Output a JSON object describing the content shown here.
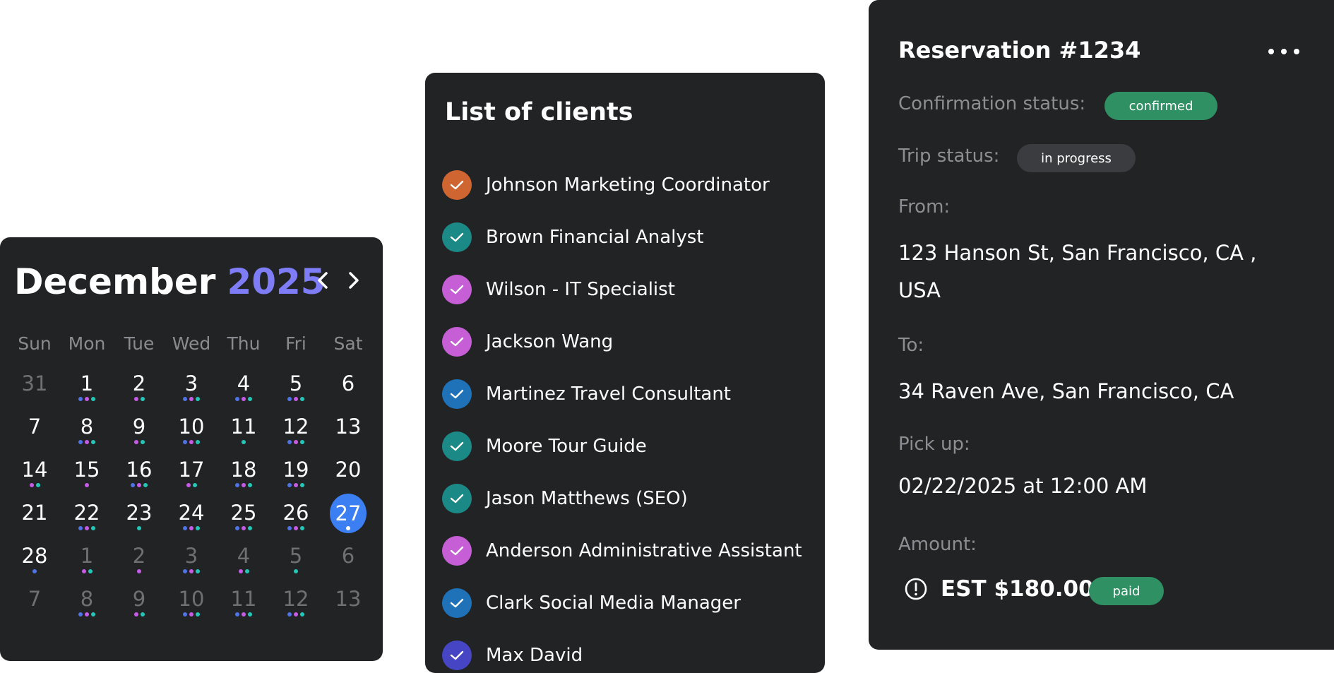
{
  "calendar": {
    "month": "December",
    "year": "2025",
    "prev_icon": "chevron-left-icon",
    "next_icon": "chevron-right-icon",
    "weekdays": [
      "Sun",
      "Mon",
      "Tue",
      "Wed",
      "Thu",
      "Fri",
      "Sat"
    ],
    "colors": {
      "text": "#ffffff",
      "muted": "#6f7074",
      "year_accent": "#7e7cf6",
      "today": "#3b7ff2",
      "dot_blue": "#4f74e8",
      "dot_purple": "#c65be6",
      "dot_teal": "#22c7b8"
    },
    "days": [
      {
        "day": "31",
        "muted": true,
        "dots": []
      },
      {
        "day": "1",
        "muted": false,
        "dots": [
          "blue",
          "purple",
          "teal"
        ]
      },
      {
        "day": "2",
        "muted": false,
        "dots": [
          "purple",
          "teal"
        ]
      },
      {
        "day": "3",
        "muted": false,
        "dots": [
          "blue",
          "purple",
          "teal"
        ]
      },
      {
        "day": "4",
        "muted": false,
        "dots": [
          "blue",
          "purple",
          "teal"
        ]
      },
      {
        "day": "5",
        "muted": false,
        "dots": [
          "blue",
          "purple",
          "teal"
        ]
      },
      {
        "day": "6",
        "muted": false,
        "dots": []
      },
      {
        "day": "7",
        "muted": false,
        "dots": []
      },
      {
        "day": "8",
        "muted": false,
        "dots": [
          "blue",
          "purple",
          "teal"
        ]
      },
      {
        "day": "9",
        "muted": false,
        "dots": [
          "purple",
          "teal"
        ]
      },
      {
        "day": "10",
        "muted": false,
        "dots": [
          "blue",
          "purple",
          "teal"
        ]
      },
      {
        "day": "11",
        "muted": false,
        "dots": [
          "teal"
        ]
      },
      {
        "day": "12",
        "muted": false,
        "dots": [
          "blue",
          "purple",
          "teal"
        ]
      },
      {
        "day": "13",
        "muted": false,
        "dots": []
      },
      {
        "day": "14",
        "muted": false,
        "dots": [
          "purple",
          "teal"
        ]
      },
      {
        "day": "15",
        "muted": false,
        "dots": [
          "purple"
        ]
      },
      {
        "day": "16",
        "muted": false,
        "dots": [
          "blue",
          "purple",
          "teal"
        ]
      },
      {
        "day": "17",
        "muted": false,
        "dots": [
          "purple",
          "teal"
        ]
      },
      {
        "day": "18",
        "muted": false,
        "dots": [
          "blue",
          "purple",
          "teal"
        ]
      },
      {
        "day": "19",
        "muted": false,
        "dots": [
          "blue",
          "purple",
          "teal"
        ]
      },
      {
        "day": "20",
        "muted": false,
        "dots": []
      },
      {
        "day": "21",
        "muted": false,
        "dots": []
      },
      {
        "day": "22",
        "muted": false,
        "dots": [
          "blue",
          "purple",
          "teal"
        ]
      },
      {
        "day": "23",
        "muted": false,
        "dots": [
          "teal"
        ]
      },
      {
        "day": "24",
        "muted": false,
        "dots": [
          "blue",
          "purple",
          "teal"
        ]
      },
      {
        "day": "25",
        "muted": false,
        "dots": [
          "blue",
          "purple",
          "teal"
        ]
      },
      {
        "day": "26",
        "muted": false,
        "dots": [
          "blue",
          "purple",
          "teal"
        ]
      },
      {
        "day": "27",
        "muted": false,
        "today": true,
        "dots": [
          "white"
        ]
      },
      {
        "day": "28",
        "muted": false,
        "dots": [
          "blue"
        ]
      },
      {
        "day": "1",
        "muted": true,
        "dots": [
          "purple",
          "teal"
        ]
      },
      {
        "day": "2",
        "muted": true,
        "dots": [
          "purple"
        ]
      },
      {
        "day": "3",
        "muted": true,
        "dots": [
          "blue",
          "purple",
          "teal"
        ]
      },
      {
        "day": "4",
        "muted": true,
        "dots": [
          "purple",
          "teal"
        ]
      },
      {
        "day": "5",
        "muted": true,
        "dots": [
          "teal"
        ]
      },
      {
        "day": "6",
        "muted": true,
        "dots": []
      },
      {
        "day": "7",
        "muted": true,
        "dots": []
      },
      {
        "day": "8",
        "muted": true,
        "dots": [
          "blue",
          "purple",
          "teal"
        ]
      },
      {
        "day": "9",
        "muted": true,
        "dots": [
          "purple",
          "teal"
        ]
      },
      {
        "day": "10",
        "muted": true,
        "dots": [
          "blue",
          "purple",
          "teal"
        ]
      },
      {
        "day": "11",
        "muted": true,
        "dots": [
          "blue",
          "purple",
          "teal"
        ]
      },
      {
        "day": "12",
        "muted": true,
        "dots": [
          "blue",
          "purple",
          "teal"
        ]
      },
      {
        "day": "13",
        "muted": true,
        "dots": []
      }
    ]
  },
  "clients": {
    "title": "List of clients",
    "check_icon": "checkmark-icon",
    "items": [
      {
        "name": "Johnson Marketing Coordinator",
        "color": "#cf6531"
      },
      {
        "name": "Brown Financial Analyst",
        "color": "#1b8a86"
      },
      {
        "name": "Wilson - IT Specialist",
        "color": "#c65fd6"
      },
      {
        "name": "Jackson Wang",
        "color": "#c65fd6"
      },
      {
        "name": "Martinez Travel Consultant",
        "color": "#1f72b8"
      },
      {
        "name": "Moore Tour Guide",
        "color": "#1b8a86"
      },
      {
        "name": "Jason Matthews (SEO)",
        "color": "#1b8a86"
      },
      {
        "name": "Anderson Administrative Assistant",
        "color": "#c65fd6"
      },
      {
        "name": "Clark Social Media Manager",
        "color": "#1f72b8"
      },
      {
        "name": "Max David",
        "color": "#4646c4"
      }
    ]
  },
  "reservation": {
    "title": "Reservation #1234",
    "more_icon": "more-horizontal-icon",
    "confirmation_label": "Confirmation status:",
    "confirmation_value": "confirmed",
    "trip_label": "Trip status:",
    "trip_value": "in progress",
    "from_label": "From:",
    "from_value": "123 Hanson St, San Francisco, CA , USA",
    "to_label": "To:",
    "to_value": "34 Raven Ave, San Francisco, CA",
    "pickup_label": "Pick up:",
    "pickup_value": "02/22/2025 at 12:00 AM",
    "amount_label": "Amount:",
    "amount_icon": "alert-circle-icon",
    "amount_value": "EST $180.00",
    "payment_status": "paid",
    "colors": {
      "success": "#2e9063",
      "neutral_badge": "#3a3c40"
    }
  }
}
